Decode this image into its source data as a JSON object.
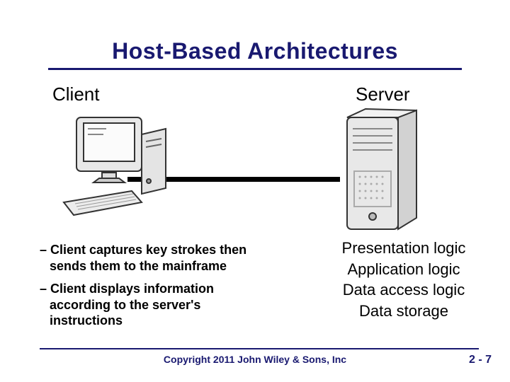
{
  "slide": {
    "title": "Host-Based Architectures",
    "client_label": "Client",
    "server_label": "Server",
    "bullets": [
      "– Client captures key strokes then sends them to the mainframe",
      "– Client displays information according to the server's instructions"
    ],
    "server_layers": [
      "Presentation logic",
      "Application logic",
      "Data access logic",
      "Data storage"
    ],
    "copyright": "Copyright 2011 John Wiley & Sons, Inc",
    "page_number": "2 - 7"
  },
  "icons": {
    "client": "client-computer-icon",
    "server": "server-tower-icon"
  },
  "colors": {
    "heading": "#191970",
    "text": "#000000",
    "rule": "#191970"
  }
}
